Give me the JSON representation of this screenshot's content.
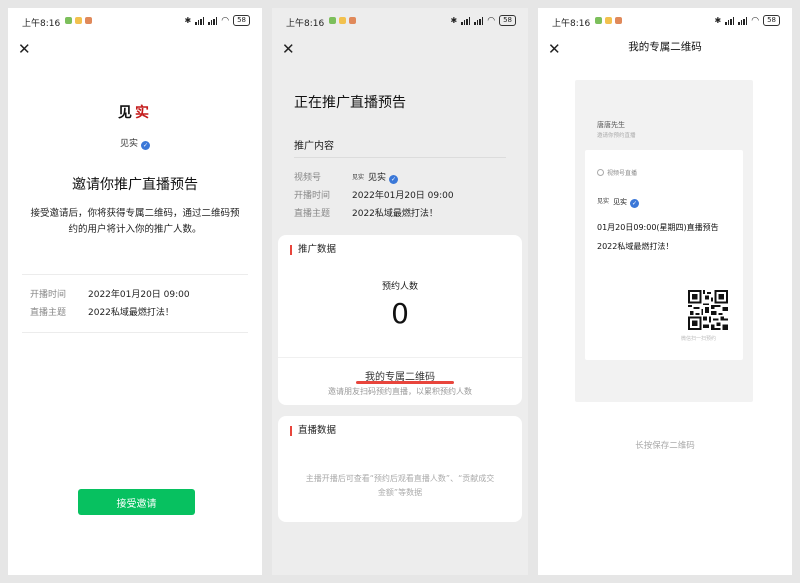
{
  "status_bar": {
    "time": "上午8:16",
    "battery": "58",
    "app_dot_colors": [
      "#7cbf5b",
      "#f2c14e",
      "#e0895a"
    ]
  },
  "invite_screen": {
    "logo_black": "见",
    "logo_red": "实",
    "account_name": "见实",
    "title": "邀请你推广直播预告",
    "description": "接受邀请后，你将获得专属二维码，通过二维码预约的用户将计入你的推广人数。",
    "fields": [
      {
        "label": "开播时间",
        "value": "2022年01月20日 09:00"
      },
      {
        "label": "直播主题",
        "value": "2022私域最燃打法！"
      }
    ],
    "accept_button": "接受邀请",
    "accent_color": "#07c160"
  },
  "promo_screen": {
    "title": "正在推广直播预告",
    "section_title": "推广内容",
    "fields": [
      {
        "label": "视频号",
        "logo": "见实",
        "value": "见实"
      },
      {
        "label": "开播时间",
        "value": "2022年01月20日 09:00"
      },
      {
        "label": "直播主题",
        "value": "2022私域最燃打法！"
      }
    ],
    "promo_data": {
      "title": "推广数据",
      "stat_label": "预约人数",
      "stat_value": "0",
      "qr_link": "我的专属二维码",
      "qr_hint": "邀请朋友扫码预约直播，以累积预约人数"
    },
    "live_data": {
      "title": "直播数据",
      "hint": "主播开播后可查看“预约后观看直播人数”、“贡献成交金额”等数据"
    },
    "accent_color": "#e8453c"
  },
  "qr_screen": {
    "title": "我的专属二维码",
    "user_name": "唐唐先生",
    "user_subtitle": "邀请你预约直播",
    "card_type": "视频号直播",
    "account_logo": "见实",
    "account_name": "见实",
    "live_line": "01月20日09:00(星期四)直播预告",
    "topic": "2022私域最燃打法！",
    "scan_hint": "微信扫一扫预约",
    "save_hint": "长按保存二维码"
  }
}
